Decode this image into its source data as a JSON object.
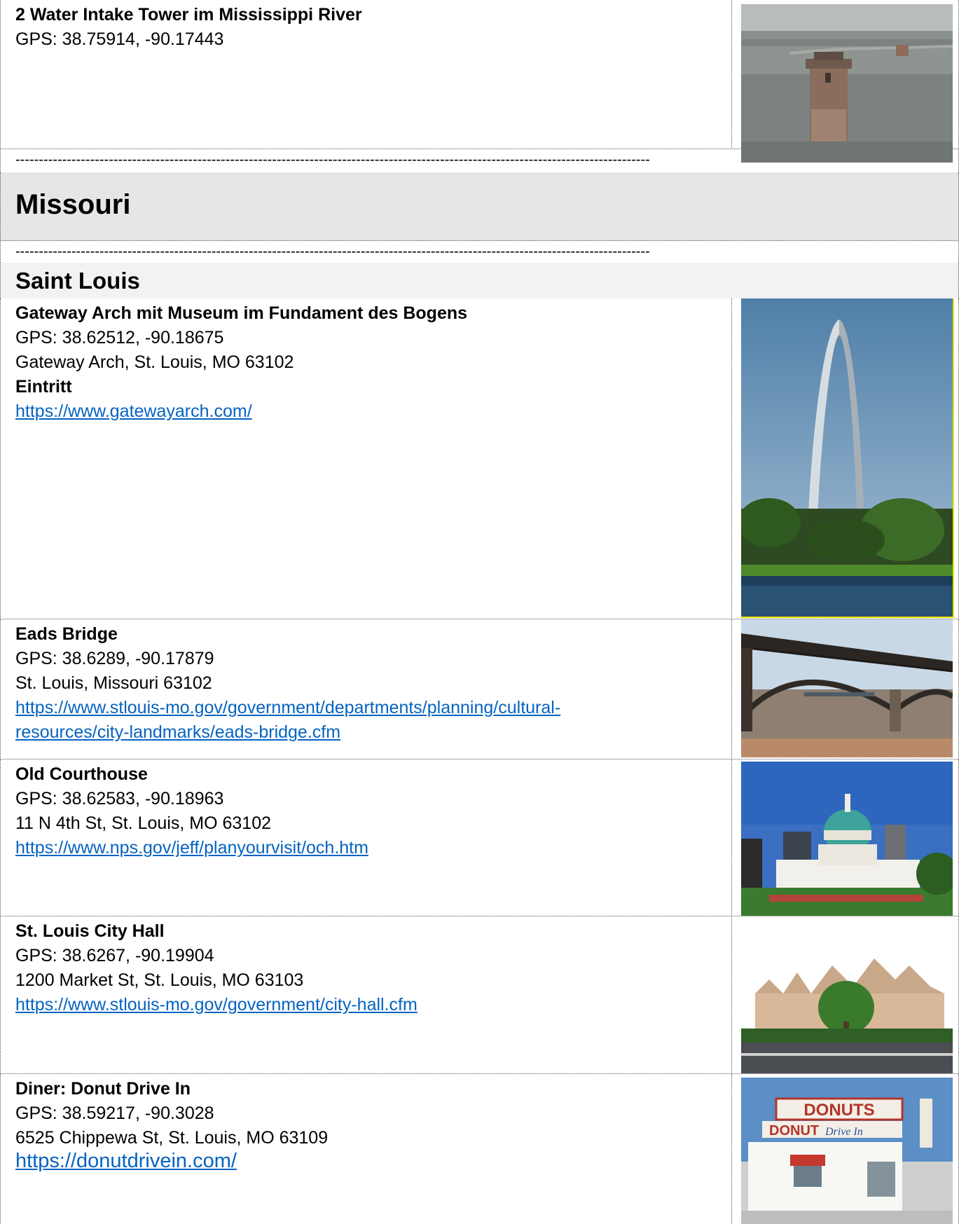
{
  "sections": {
    "intake": {
      "title": "2 Water Intake Tower im Mississippi River",
      "gps": "GPS: 38.75914, -90.17443"
    },
    "separator": "----------------------------------------------------------------------------------------------------------------------------------------",
    "state_heading": "Missouri",
    "city_heading": "Saint Louis",
    "entries": [
      {
        "title": "Gateway Arch mit Museum im Fundament des Bogens",
        "gps": "GPS: 38.62512, -90.18675",
        "address": "Gateway Arch, St. Louis, MO 63102",
        "extra": "Eintritt",
        "link": "https://www.gatewayarch.com/"
      },
      {
        "title": "Eads Bridge",
        "gps": "GPS: 38.6289, -90.17879",
        "address": "St. Louis, Missouri 63102",
        "link_line1": "https://www.stlouis-mo.gov/government/departments/planning/cultural-",
        "link_line2": "resources/city-landmarks/eads-bridge.cfm"
      },
      {
        "title": "Old Courthouse",
        "gps": "GPS: 38.62583, -90.18963",
        "address": "11 N 4th St, St. Louis, MO 63102",
        "link": "https://www.nps.gov/jeff/planyourvisit/och.htm"
      },
      {
        "title": "St. Louis City Hall",
        "gps": "GPS: 38.6267, -90.19904",
        "address": "1200 Market St, St. Louis, MO 63103",
        "link": "https://www.stlouis-mo.gov/government/city-hall.cfm"
      },
      {
        "title": "Diner: Donut Drive In",
        "gps": "GPS: 38.59217, -90.3028",
        "address": "6525 Chippewa St, St. Louis, MO 63109",
        "link": "https://donutdrivein.com/"
      }
    ],
    "donut_sign": {
      "big": "DONUTS",
      "small": "DONUT",
      "script": "Drive In"
    }
  },
  "colors": {
    "link": "#0563c1",
    "state_bg": "#e6e6e6",
    "city_bg": "#f2f2f2"
  }
}
